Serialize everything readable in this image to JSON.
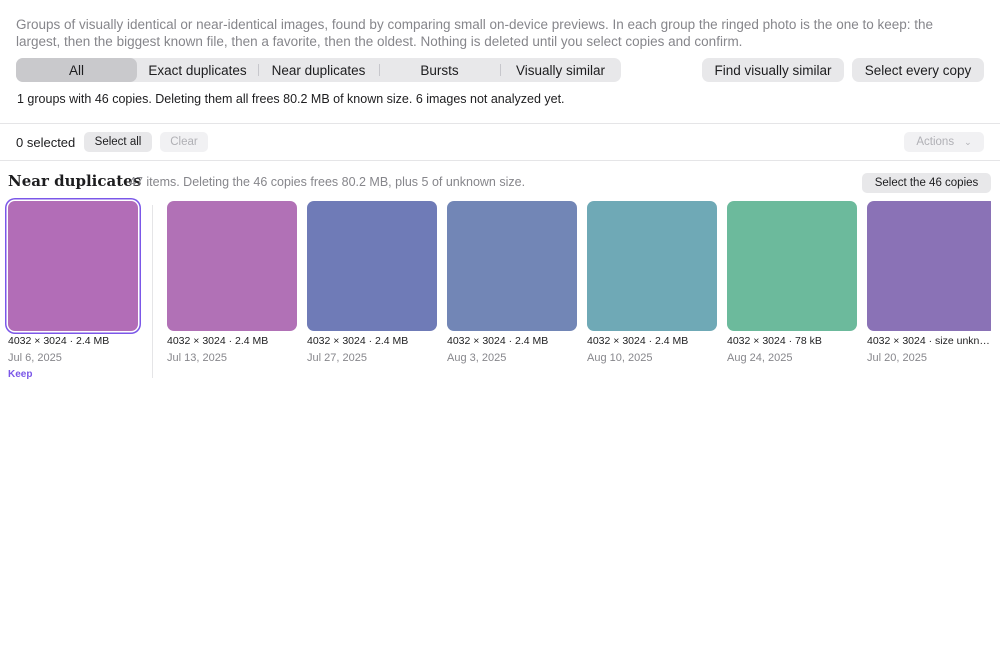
{
  "description": "Groups of visually identical or near-identical images, found by comparing small on-device previews. In each group the ringed photo is the one to keep: the largest, then the biggest known file, then a favorite, then the oldest. Nothing is deleted until you select copies and confirm.",
  "filter_tabs": [
    "All",
    "Exact duplicates",
    "Near duplicates",
    "Bursts",
    "Visually similar"
  ],
  "find_similar_label": "Find visually similar",
  "select_every_copy_label": "Select every copy",
  "summary": "1 groups with 46 copies. Deleting them all frees 80.2 MB of known size. 6 images not analyzed yet.",
  "selection": {
    "count_text": "0 selected",
    "select_all_label": "Select all",
    "clear_label": "Clear",
    "actions_label": "Actions",
    "actions_icon": "chevron-down-icon"
  },
  "group": {
    "title": "Near duplicates",
    "subtitle": "47 items. Deleting the 46 copies frees 80.2 MB, plus 5 of unknown size.",
    "select_copies_label": "Select the 46 copies",
    "keep_label": "Keep",
    "items": [
      {
        "meta": "4032 × 3024 · 2.4 MB",
        "date": "Jul 6, 2025",
        "color": "#b26db7",
        "keep": true
      },
      {
        "meta": "4032 × 3024 · 2.4 MB",
        "date": "Jul 13, 2025",
        "color": "#b171b6"
      },
      {
        "meta": "4032 × 3024 · 2.4 MB",
        "date": "Jul 27, 2025",
        "color": "#6f7bb7"
      },
      {
        "meta": "4032 × 3024 · 2.4 MB",
        "date": "Aug 3, 2025",
        "color": "#7286b6"
      },
      {
        "meta": "4032 × 3024 · 2.4 MB",
        "date": "Aug 10, 2025",
        "color": "#6fa9b6"
      },
      {
        "meta": "4032 × 3024 · 78 kB",
        "date": "Aug 24, 2025",
        "color": "#6cba9c"
      },
      {
        "meta": "4032 × 3024 · size unkn…",
        "date": "Jul 20, 2025",
        "color": "#8a72b6"
      }
    ]
  },
  "accent": "#7b57e8"
}
